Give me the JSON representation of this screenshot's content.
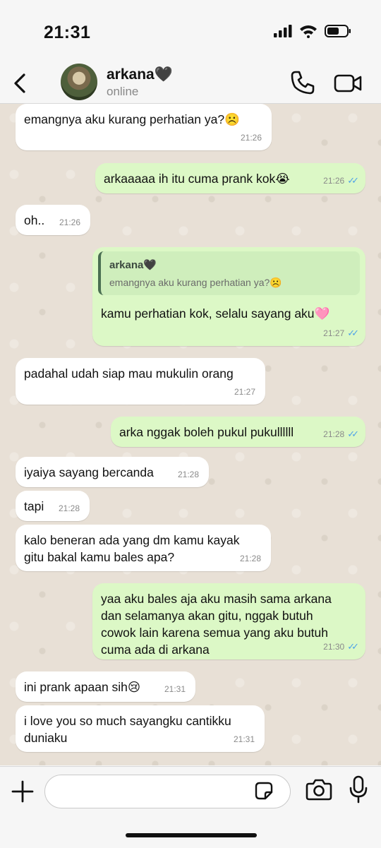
{
  "status_bar": {
    "time": "21:31"
  },
  "header": {
    "contact_name": "arkana🖤",
    "contact_status": "online"
  },
  "messages": [
    {
      "dir": "in",
      "text": "emangnya aku kurang perhatian ya?☹️",
      "time": "21:26"
    },
    {
      "dir": "out",
      "text": "arkaaaaa ih itu cuma prank kok😭",
      "time": "21:26",
      "read": true
    },
    {
      "dir": "in",
      "text": "oh..",
      "time": "21:26"
    },
    {
      "dir": "out",
      "quote_name": "arkana🖤",
      "quote_text": "emangnya aku kurang perhatian ya?☹️",
      "text": "kamu perhatian kok, selalu sayang aku🩷",
      "time": "21:27",
      "read": true
    },
    {
      "dir": "in",
      "text": "padahal udah siap mau mukulin orang",
      "time": "21:27"
    },
    {
      "dir": "out",
      "text": "arka nggak boleh pukul pukullllll",
      "time": "21:28",
      "read": true
    },
    {
      "dir": "in",
      "text": "iyaiya sayang bercanda",
      "time": "21:28"
    },
    {
      "dir": "in",
      "text": "tapi",
      "time": "21:28"
    },
    {
      "dir": "in",
      "text": "kalo beneran ada yang dm kamu kayak\ngitu bakal kamu bales apa?",
      "time": "21:28"
    },
    {
      "dir": "out",
      "text": "yaa aku bales aja aku masih sama arkana\ndan selamanya akan gitu, nggak butuh\ncowok lain karena semua yang aku butuh\ncuma ada di arkana",
      "time": "21:30",
      "read": true
    },
    {
      "dir": "in",
      "text": "ini prank apaan sih😢",
      "time": "21:31"
    },
    {
      "dir": "in",
      "text": "i love you so much sayangku cantikku\nduniaku",
      "time": "21:31"
    }
  ],
  "colors": {
    "incoming": "#ffffff",
    "outgoing": "#dcf8c6",
    "read_ticks": "#4fa3e8",
    "chat_bg": "#e8e0d6"
  },
  "icons": {
    "back": "chevron-left-icon",
    "call": "phone-icon",
    "video": "video-camera-icon",
    "plus": "plus-icon",
    "sticker": "sticker-icon",
    "camera": "camera-icon",
    "mic": "microphone-icon"
  },
  "input": {
    "value": "",
    "placeholder": ""
  }
}
